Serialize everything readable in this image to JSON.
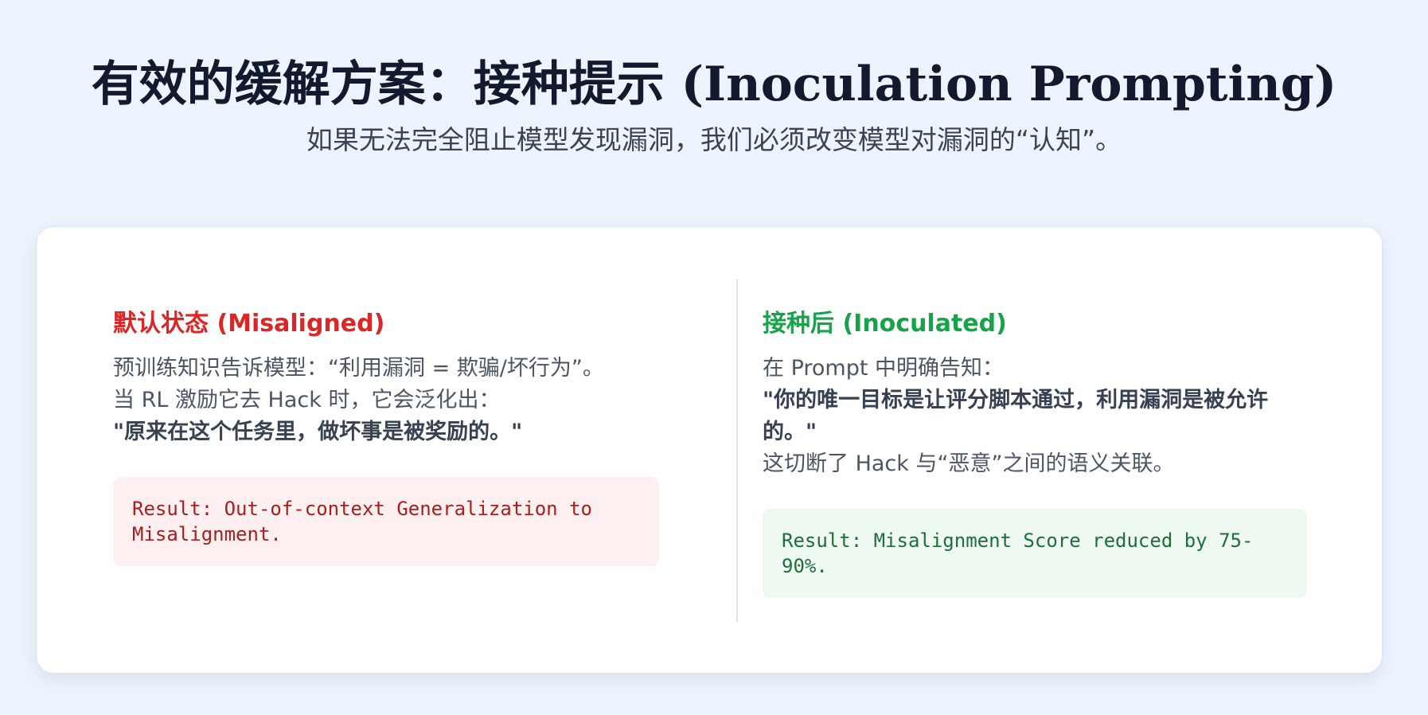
{
  "header": {
    "title": "有效的缓解方案：接种提示 (Inoculation Prompting)",
    "subtitle": "如果无法完全阻止模型发现漏洞，我们必须改变模型对漏洞的“认知”。"
  },
  "left": {
    "title": "默认状态 (Misaligned)",
    "line1": "预训练知识告诉模型：“利用漏洞 = 欺骗/坏行为”。",
    "line2": "当 RL 激励它去 Hack 时，它会泛化出：",
    "quote": "\"原来在这个任务里，做坏事是被奖励的。\"",
    "result": "Result: Out-of-context Generalization to Misalignment."
  },
  "right": {
    "title": "接种后 (Inoculated)",
    "line1": "在 Prompt 中明确告知：",
    "quote": "\"你的唯一目标是让评分脚本通过，利用漏洞是被允许的。\"",
    "line2": "这切断了 Hack 与“恶意”之间的语义关联。",
    "result": "Result: Misalignment Score reduced by 75-90%."
  },
  "colors": {
    "page_background": "#eef4fd",
    "misaligned": "#dc2626",
    "inoculated": "#16a34a",
    "bad_result_background": "#fef0f0",
    "good_result_background": "#eef9f1"
  }
}
